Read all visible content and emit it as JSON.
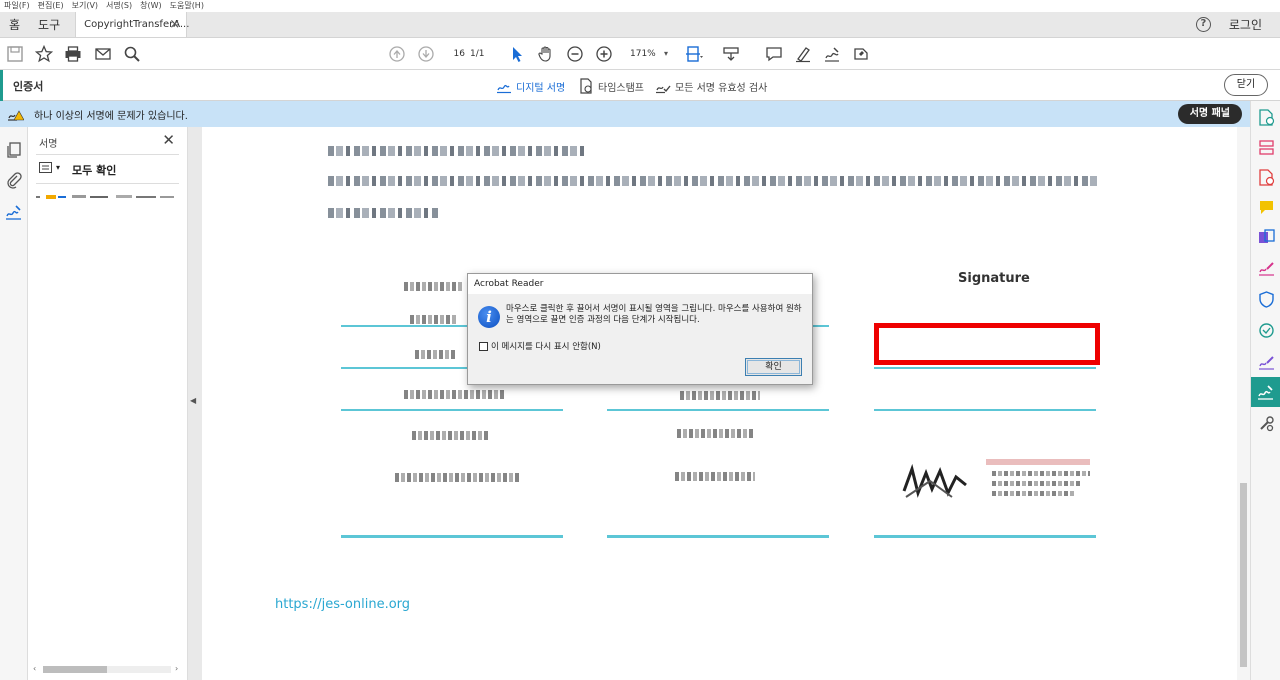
{
  "menu": [
    "파일(F)",
    "편집(E)",
    "보기(V)",
    "서명(S)",
    "창(W)",
    "도움말(H)"
  ],
  "tabs": {
    "home": "홈",
    "tools": "도구",
    "document": "CopyrightTransferA...",
    "login": "로그인"
  },
  "toolbar": {
    "page_current": "16",
    "page_total": "1/1",
    "zoom": "171%"
  },
  "cert_bar": {
    "title": "인증서",
    "digital_sign": "디지털 서명",
    "timestamp": "타임스탬프",
    "validate_all": "모든 서명 유효성 검사",
    "close": "닫기"
  },
  "warning": {
    "message": "하나 이상의 서명에 문제가 있습니다.",
    "panel_button": "서명 패널"
  },
  "sig_panel": {
    "header": "서명",
    "verify_all": "모두 확인"
  },
  "document": {
    "signature_header": "Signature",
    "url": "https://jes-online.org"
  },
  "dialog": {
    "title": "Acrobat Reader",
    "message": "마우스로 클릭한 후 끌어서 서명이 표시될 영역을 그립니다. 마우스를 사용하여 원하는 영역으로 끌면 인증 과정의 다음 단계가 시작됩니다.",
    "checkbox_label": "이 메시지를 다시 표시 안함(N)",
    "ok": "확인"
  },
  "colors": {
    "accent": "#1f9b8f",
    "link": "#1a6dd6",
    "warning_bg": "#c8e2f7",
    "sig_box": "#ee0000"
  }
}
